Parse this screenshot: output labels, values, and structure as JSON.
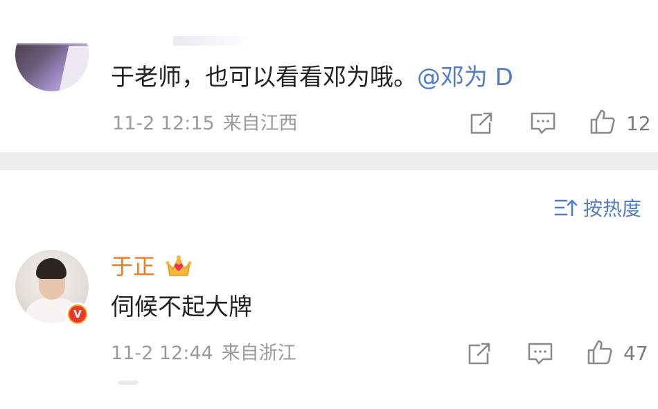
{
  "comments": [
    {
      "text": "于老师，也可以看看邓为哦。",
      "mention": "@邓为 D",
      "date": "11-2 12:15",
      "location": "来自江西",
      "likes": "12",
      "avatar_icon": "user-avatar"
    },
    {
      "username": "于正",
      "username_color": "#f07a22",
      "badge_icon": "crown-icon",
      "verified_letter": "V",
      "text": "伺候不起大牌",
      "date": "11-2 12:44",
      "location": "来自浙江",
      "likes": "47",
      "avatar_icon": "user-avatar"
    }
  ],
  "sort": {
    "label": "按热度",
    "icon": "sort-icon"
  },
  "actions": {
    "share_icon": "share-icon",
    "comment_icon": "comment-icon",
    "like_icon": "like-icon"
  },
  "colors": {
    "accent": "#4f7cc9",
    "meta_text": "#9a9a9a",
    "divider": "#eeeeee",
    "vip_name": "#f07a22"
  }
}
